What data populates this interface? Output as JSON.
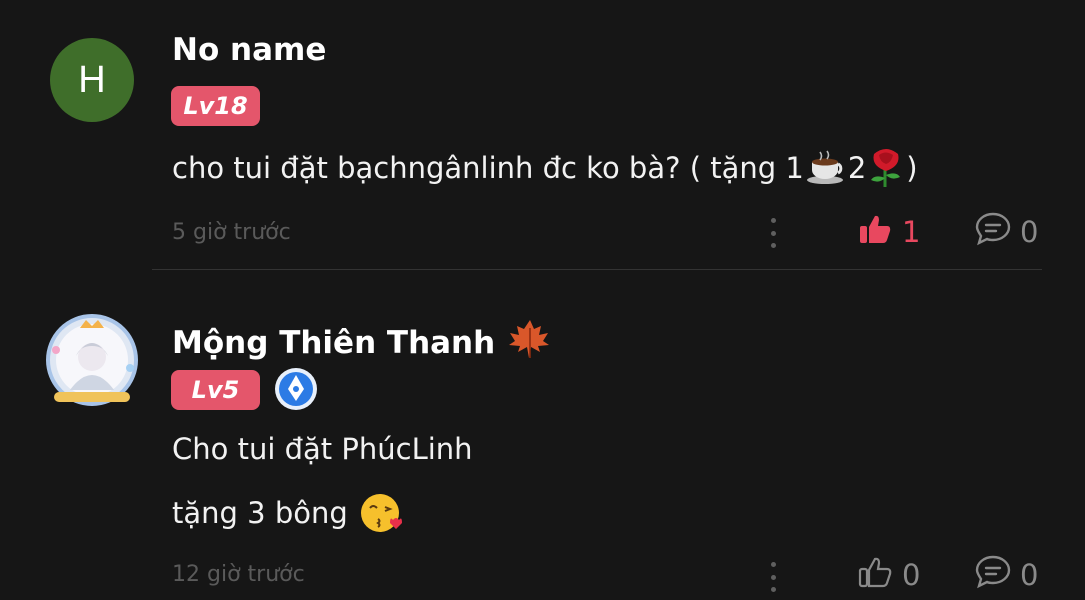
{
  "comments": [
    {
      "avatar_letter": "H",
      "avatar_color": "#3f6e2a",
      "name": "No name",
      "level": "Lv18",
      "text_before": "cho tui đặt bạchngânlinh đc ko bà? ( tặng 1 ",
      "gift_count": "2",
      "text_after": ")",
      "time": "5 giờ trước",
      "likes": "1",
      "liked": true,
      "replies": "0"
    },
    {
      "name": "Mộng Thiên Thanh",
      "level": "Lv5",
      "line1": "Cho tui đặt PhúcLinh",
      "line2": "tặng 3 bông",
      "time": "12 giờ trước",
      "likes": "0",
      "liked": false,
      "replies": "0"
    }
  ],
  "colors": {
    "background": "#161616",
    "level_badge": "#e4566b",
    "like_active": "#e8485f",
    "muted": "#8a8a8a"
  },
  "icons": [
    "coffee-icon",
    "rose-icon",
    "maple-leaf-icon",
    "verified-pen-badge-icon",
    "kiss-emoji-icon",
    "thumbs-up-icon",
    "comment-bubble-icon",
    "more-vertical-icon"
  ]
}
